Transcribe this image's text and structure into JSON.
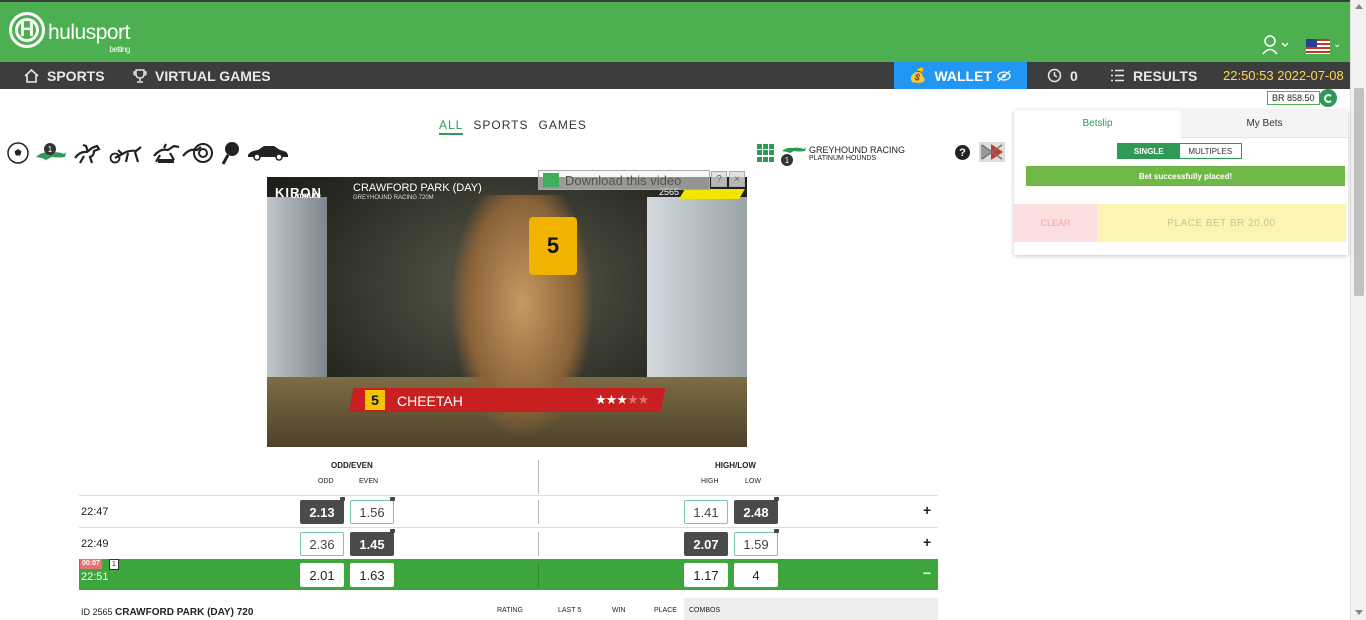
{
  "brand": {
    "name": "hulusport",
    "tagline": "betting",
    "logo_letter": "H"
  },
  "nav": {
    "sports": "SPORTS",
    "virtual_games": "VIRTUAL GAMES",
    "wallet": "WALLET",
    "history_count": "0",
    "results": "RESULTS",
    "datetime": "22:50:53 2022-07-08"
  },
  "account": {
    "balance": "BR 858.50",
    "language_flag": "us-flag-icon"
  },
  "game_tabs": [
    "ALL",
    "SPORTS",
    "GAMES"
  ],
  "sport_icons": [
    "soccer-ball-icon",
    "greyhound-icon",
    "horse-racing-icon",
    "harness-racing-icon",
    "steeplechase-icon",
    "motorbike-racing-icon",
    "tennis-icon",
    "car-racing-icon"
  ],
  "sport_badge": "1",
  "event_header": {
    "grid_badge": "1",
    "title": "GREYHOUND RACING",
    "subtitle": "PLATINUM HOUNDS"
  },
  "video": {
    "logo": "KIRON",
    "unmute": "Unmute",
    "title": "CRAWFORD PARK (DAY)",
    "subtitle": "GREYHOUND RACING   720M",
    "race_id": "2565",
    "runner_number": "5",
    "runner_name": "CHEETAH",
    "stars": "★★★",
    "stars_dim": "★★",
    "download_text": "Download this video",
    "download_help": "?",
    "download_close": "×"
  },
  "markets": {
    "odd_even": {
      "title": "ODD/EVEN",
      "col1": "ODD",
      "col2": "EVEN"
    },
    "high_low": {
      "title": "HIGH/LOW",
      "col1": "HIGH",
      "col2": "LOW"
    }
  },
  "rows": [
    {
      "time": "22:47",
      "odd": "2.13",
      "even": "1.56",
      "high": "1.41",
      "low": "2.48",
      "toggle": "+"
    },
    {
      "time": "22:49",
      "odd": "2.36",
      "even": "1.45",
      "high": "2.07",
      "low": "1.59",
      "toggle": "+"
    },
    {
      "time": "22:51",
      "odd": "2.01",
      "even": "1.63",
      "high": "1.17",
      "low": "4",
      "toggle": "−",
      "countdown": "00:07",
      "badge": "1"
    }
  ],
  "race_table": {
    "id_label": "ID 2565",
    "race_name": "CRAWFORD PARK (DAY) 720",
    "cols": [
      "RATING",
      "LAST 5",
      "WIN",
      "PLACE",
      "COMBOS"
    ]
  },
  "betslip": {
    "tab_betslip": "Betslip",
    "tab_mybets": "My Bets",
    "single": "SINGLE",
    "multiples": "MULTIPLES",
    "success": "Bet successfully placed!",
    "clear": "CLEAR",
    "place_bet": "PLACE BET  BR 20.00"
  },
  "colors": {
    "brand_green": "#4caf50",
    "nav_dark": "#3d3d3d",
    "wallet_blue": "#2196f3",
    "clock_yellow": "#ffd54f",
    "live_row": "#3ca53c"
  }
}
